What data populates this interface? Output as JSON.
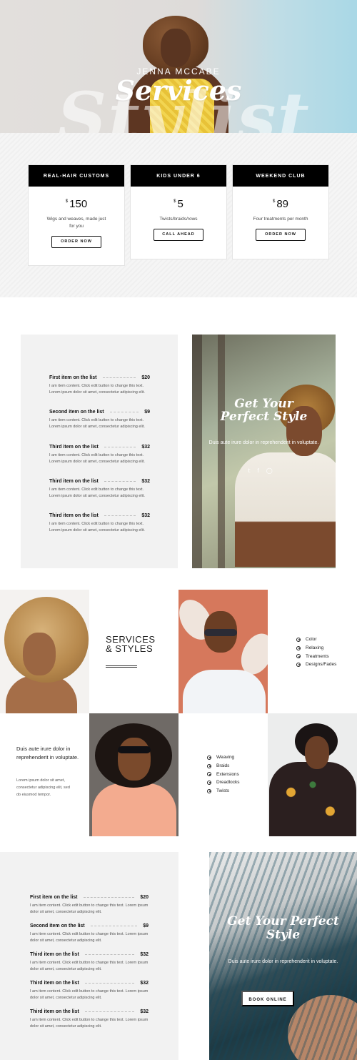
{
  "hero": {
    "subtitle": "JENNA MCCABE",
    "title": "Services",
    "background_script": "Stylist"
  },
  "pricing": {
    "cards": [
      {
        "heading": "REAL-HAIR CUSTOMS",
        "currency": "$",
        "price": "150",
        "description": "Wigs and weaves, made just for you",
        "button": "ORDER NOW"
      },
      {
        "heading": "KIDS UNDER 6",
        "currency": "$",
        "price": "5",
        "description": "Twists/braids/rows",
        "button": "CALL AHEAD"
      },
      {
        "heading": "WEEKEND CLUB",
        "currency": "$",
        "price": "89",
        "description": "Four treatments per month",
        "button": "ORDER NOW"
      }
    ]
  },
  "menu1": {
    "items": [
      {
        "name": "First item on the list",
        "price": "$20",
        "text": "I am item content. Click edit button to change this text. Lorem ipsum dolor sit amet, consectetur adipiscing elit."
      },
      {
        "name": "Second item on the list",
        "price": "$9",
        "text": "I am item content. Click edit button to change this text. Lorem ipsum dolor sit amet, consectetur adipiscing elit."
      },
      {
        "name": "Third item on the list",
        "price": "$32",
        "text": "I am item content. Click edit button to change this text. Lorem ipsum dolor sit amet, consectetur adipiscing elit."
      },
      {
        "name": "Third item on the list",
        "price": "$32",
        "text": "I am item content. Click edit button to change this text. Lorem ipsum dolor sit amet, consectetur adipiscing elit."
      },
      {
        "name": "Third item on the list",
        "price": "$32",
        "text": "I am item content. Click edit button to change this text. Lorem ipsum dolor sit amet, consectetur adipiscing elit."
      }
    ],
    "promo": {
      "title_line1": "Get Your",
      "title_line2": "Perfect Style",
      "text": "Duis aute irure dolor in reprehenderit in voluptate.",
      "social": [
        "twitter-icon",
        "facebook-icon",
        "instagram-icon"
      ]
    }
  },
  "gallery": {
    "heading_line1": "SERVICES",
    "heading_line2": "& STYLES",
    "list1": [
      "Color",
      "Relaxing",
      "Treatments",
      "Designs/Fades"
    ],
    "list2": [
      "Weaving",
      "Braids",
      "Extensions",
      "Dreadlocks",
      "Twists"
    ],
    "intro_heading": "Duis aute irure dolor in reprehenderit in voluptate.",
    "intro_text": "Lorem ipsum dolor sit amet, consectetur adipiscing elit, sed do eiusmod tempor."
  },
  "menu2": {
    "items": [
      {
        "name": "First item on the list",
        "price": "$20",
        "text": "I am item content. Click edit button to change this text. Lorem ipsum dolor sit amet, consectetur adipiscing elit."
      },
      {
        "name": "Second item on the list",
        "price": "$9",
        "text": "I am item content. Click edit button to change this text. Lorem ipsum dolor sit amet, consectetur adipiscing elit."
      },
      {
        "name": "Third item on the list",
        "price": "$32",
        "text": "I am item content. Click edit button to change this text. Lorem ipsum dolor sit amet, consectetur adipiscing elit."
      },
      {
        "name": "Third item on the list",
        "price": "$32",
        "text": "I am item content. Click edit button to change this text. Lorem ipsum dolor sit amet, consectetur adipiscing elit."
      },
      {
        "name": "Third item on the list",
        "price": "$32",
        "text": "I am item content. Click edit button to change this text. Lorem ipsum dolor sit amet, consectetur adipiscing elit."
      }
    ],
    "promo": {
      "title_line1": "Get Your Perfect",
      "title_line2": "Style",
      "text": "Duis aute irure dolor in reprehenderit in voluptate.",
      "button": "BOOK ONLINE"
    }
  },
  "colors": {
    "card_header": "#000000",
    "panel_bg": "#f2f2f2",
    "accent_dress": "#e8c238"
  }
}
